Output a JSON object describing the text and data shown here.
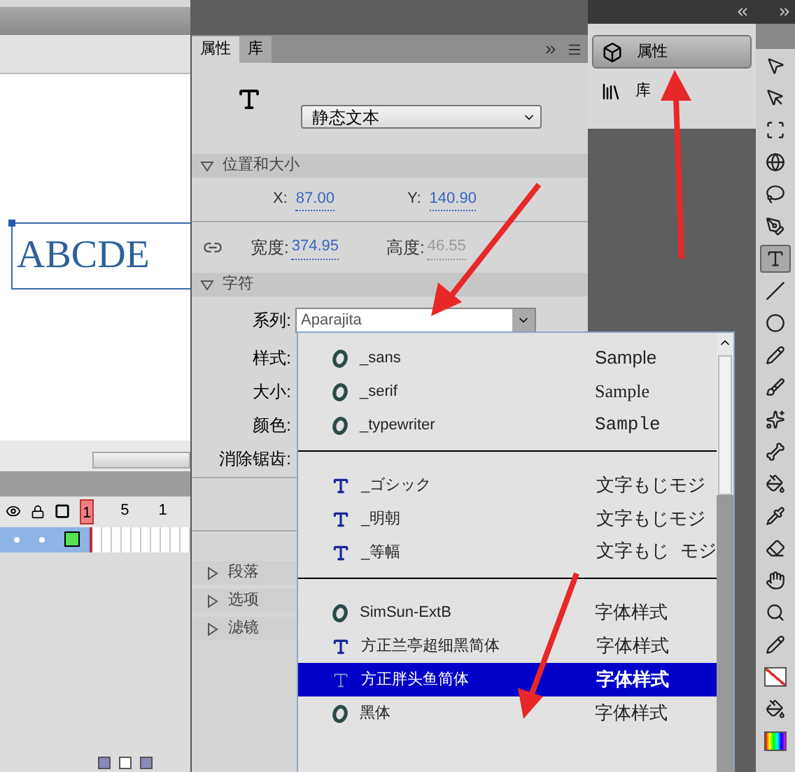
{
  "stage": {
    "text": "ABCDE"
  },
  "timeline": {
    "frame_numbers": [
      "1",
      "5",
      "1"
    ],
    "layer_selected": true
  },
  "properties_panel": {
    "tabs": [
      {
        "label": "属性",
        "selected": true
      },
      {
        "label": "库",
        "selected": false
      }
    ],
    "instance_type": "静态文本",
    "position_section": {
      "title": "位置和大小",
      "expanded": true,
      "fields": [
        {
          "label": "X:",
          "value": "87.00",
          "disabled": false
        },
        {
          "label": "Y:",
          "value": "140.90",
          "disabled": false
        }
      ]
    },
    "size_fields": [
      {
        "label": "宽度:",
        "value": "374.95",
        "disabled": false
      },
      {
        "label": "高度:",
        "value": "46.55",
        "disabled": true
      }
    ],
    "character_section": {
      "title": "字符",
      "expanded": true,
      "family_label": "系列:",
      "family_value": "Aparajita",
      "labels": [
        "样式:",
        "大小:",
        "颜色:",
        "消除锯齿:"
      ]
    },
    "collapsed_sections": [
      {
        "title": "段落",
        "expanded": false
      },
      {
        "title": "选项",
        "expanded": false
      },
      {
        "title": "滤镜",
        "expanded": false
      }
    ]
  },
  "panel_dock": {
    "items": [
      {
        "label": "属性",
        "kind": "properties",
        "selected": true
      },
      {
        "label": "库",
        "kind": "library",
        "selected": false
      }
    ]
  },
  "tools": [
    {
      "kind": "selection",
      "selected": false
    },
    {
      "kind": "subselection",
      "selected": false
    },
    {
      "kind": "transform",
      "selected": false
    },
    {
      "kind": "rotate3d",
      "selected": false
    },
    {
      "kind": "lasso",
      "selected": false
    },
    {
      "kind": "pen",
      "selected": false
    },
    {
      "kind": "text",
      "selected": true
    },
    {
      "kind": "line",
      "selected": false
    },
    {
      "kind": "oval",
      "selected": false
    },
    {
      "kind": "pencil",
      "selected": false
    },
    {
      "kind": "brush",
      "selected": false
    },
    {
      "kind": "deco",
      "selected": false
    },
    {
      "kind": "bone",
      "selected": false
    },
    {
      "kind": "bucket",
      "selected": false
    },
    {
      "kind": "eyedropper",
      "selected": false
    },
    {
      "kind": "eraser",
      "selected": false
    },
    {
      "kind": "hand",
      "selected": false
    },
    {
      "kind": "zoom",
      "selected": false
    },
    {
      "kind": "stroke",
      "selected": false
    },
    {
      "kind": "strokeswatch",
      "selected": false
    },
    {
      "kind": "fill",
      "selected": false
    },
    {
      "kind": "fillswatch",
      "selected": false
    }
  ],
  "font_dropdown": {
    "groups": [
      [
        {
          "kind": "opentype",
          "name": "_sans",
          "sample": "Sample",
          "selected": false
        },
        {
          "kind": "opentype",
          "name": "_serif",
          "sample": "Sample",
          "selected": false
        },
        {
          "kind": "opentype",
          "name": "_typewriter",
          "sample": "Sample",
          "selected": false
        }
      ],
      [
        {
          "kind": "truetype",
          "name": "_ゴシック",
          "sample": "文字もじモジ",
          "selected": false
        },
        {
          "kind": "truetype",
          "name": "_明朝",
          "sample": "文字もじモジ",
          "selected": false
        },
        {
          "kind": "truetype",
          "name": "_等幅",
          "sample": "文字もじ モジ",
          "selected": false
        }
      ],
      [
        {
          "kind": "opentype",
          "name": "SimSun-ExtB",
          "sample": "字体样式",
          "selected": false
        },
        {
          "kind": "truetype",
          "name": "方正兰亭超细黑简体",
          "sample": "字体样式",
          "selected": false
        },
        {
          "kind": "truetype",
          "name": "方正胖头鱼简体",
          "sample": "字体样式",
          "selected": true
        },
        {
          "kind": "opentype",
          "name": "黑体",
          "sample": "字体样式",
          "selected": false
        }
      ]
    ]
  }
}
